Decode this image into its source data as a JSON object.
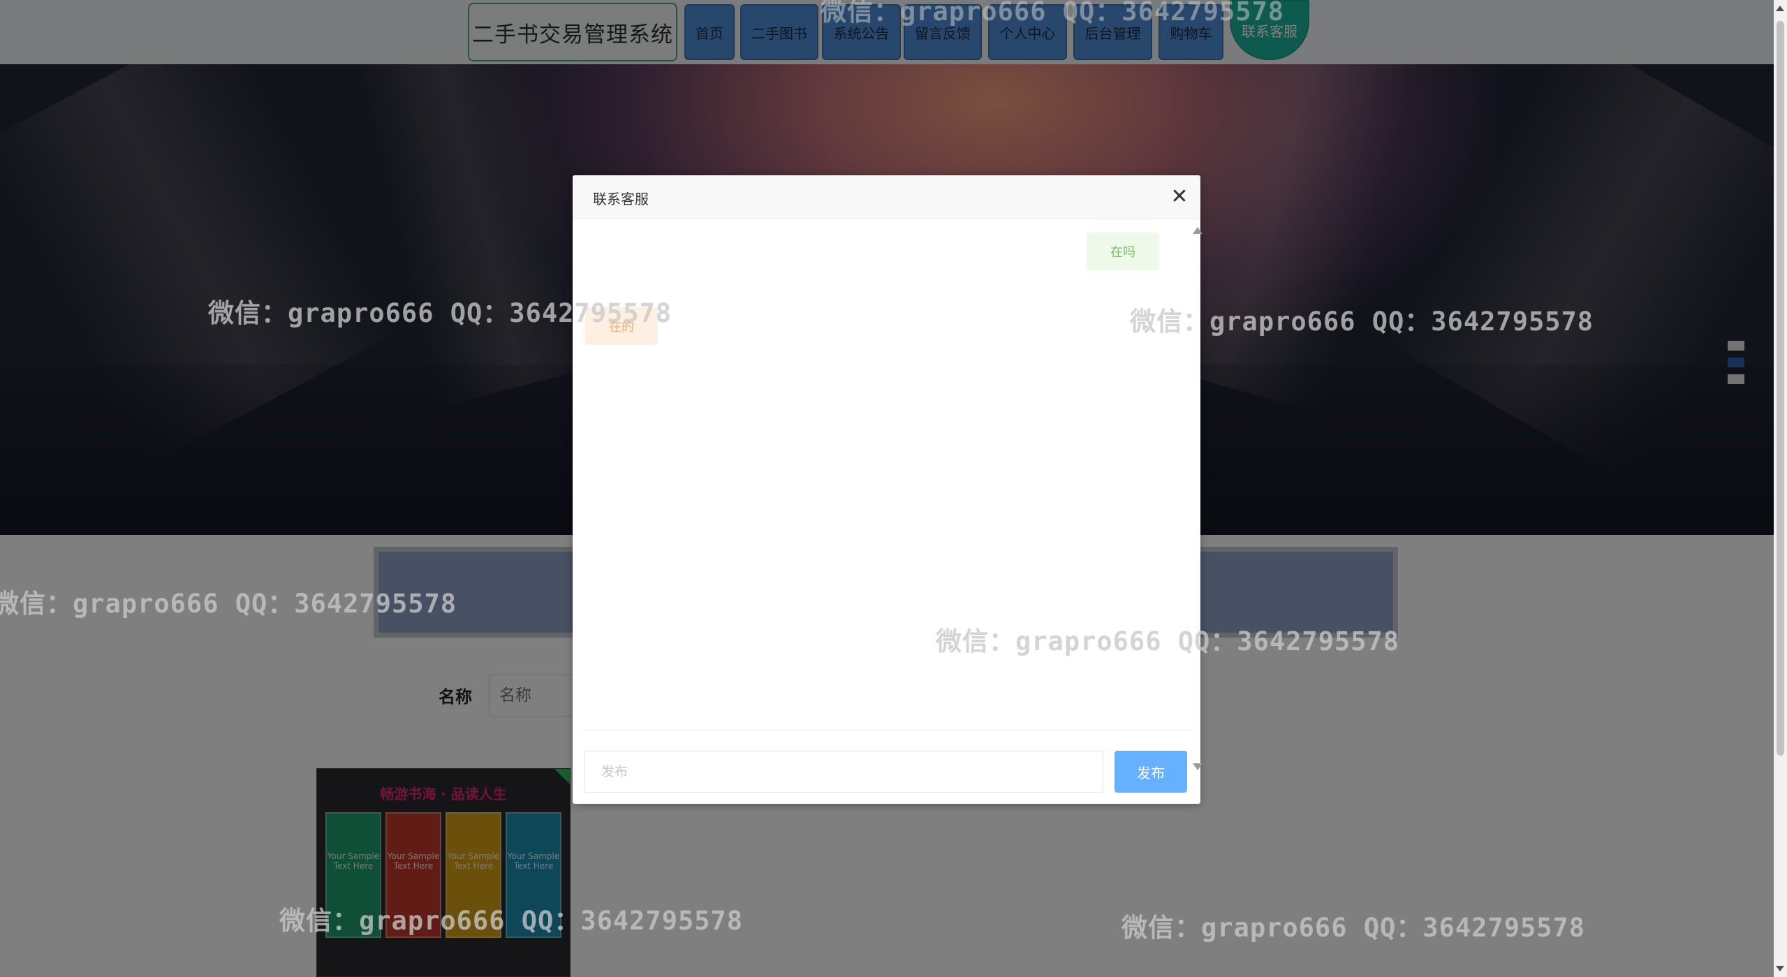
{
  "brand": {
    "title": "二手书交易管理系统"
  },
  "nav": {
    "items": [
      {
        "label": "首页"
      },
      {
        "label": "二手图书"
      },
      {
        "label": "系统公告"
      },
      {
        "label": "留言反馈"
      },
      {
        "label": "个人中心"
      },
      {
        "label": "后台管理"
      },
      {
        "label": "购物车"
      },
      {
        "label": "联系客服"
      }
    ],
    "active_index": 7
  },
  "search": {
    "label": "名称",
    "placeholder": "名称"
  },
  "modal": {
    "title": "联系客服",
    "close_glyph": "✕",
    "messages": [
      {
        "from": "user",
        "text": "在吗"
      },
      {
        "from": "service",
        "text": "在的"
      }
    ],
    "input_placeholder": "发布",
    "send_label": "发布"
  },
  "watermark": {
    "text": "微信：grapro666 QQ：3642795578"
  },
  "product": {
    "banner_text": "畅游书海 · 品读人生",
    "panel_text": "Your Sample Text Here"
  },
  "colors": {
    "nav_button": "#4f8fd8",
    "nav_active": "#1fb59f",
    "send_button": "#66b1ff",
    "bubble_mine_bg": "#eef9e9",
    "bubble_mine_text": "#78c05a",
    "bubble_theirs_bg": "#fdf0e2",
    "bubble_theirs_text": "#f0b071"
  }
}
